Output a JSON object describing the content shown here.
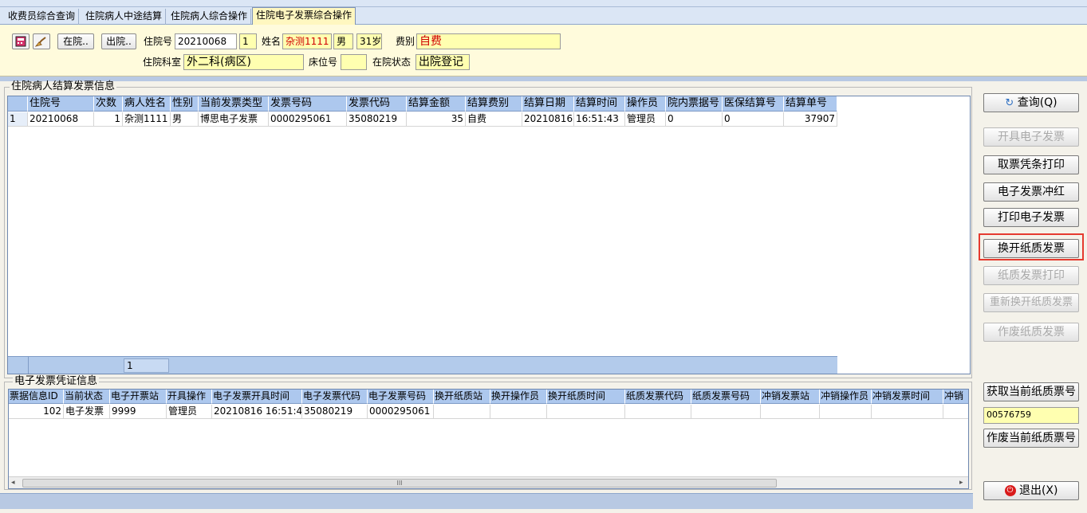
{
  "tabs": [
    {
      "label": "收费员综合查询"
    },
    {
      "label": "住院病人中途结算"
    },
    {
      "label": "住院病人综合操作"
    },
    {
      "label": "住院电子发票综合操作"
    }
  ],
  "header": {
    "btn_in": "在院..",
    "btn_out": "出院..",
    "label_zyh": "住院号",
    "zyh": "20210068",
    "times": "1",
    "label_name": "姓名",
    "name": "杂测1111",
    "sex": "男",
    "age": "31岁",
    "label_feibie": "费别",
    "feibie": "自费",
    "label_keshi": "住院科室",
    "keshi": "外二科(病区)",
    "label_bed": "床位号",
    "bed": "",
    "label_status": "在院状态",
    "status": "出院登记"
  },
  "settle_group": {
    "title": "住院病人结算发票信息",
    "columns": [
      "住院号",
      "次数",
      "病人姓名",
      "性别",
      "当前发票类型",
      "发票号码",
      "发票代码",
      "结算金额",
      "结算费别",
      "结算日期",
      "结算时间",
      "操作员",
      "院内票据号",
      "医保结算号",
      "结算单号"
    ],
    "rows": [
      {
        "idx": "1",
        "zyh": "20210068",
        "times": "1",
        "name": "杂测1111",
        "sex": "男",
        "type": "博思电子发票",
        "fphm": "0000295061",
        "fpdm": "35080219",
        "amount": "35",
        "feibie": "自费",
        "date": "20210816",
        "time": "16:51:43",
        "oper": "管理员",
        "ynph": "0",
        "ybjs": "0",
        "jsdh": "37907"
      }
    ],
    "footer_count": "1"
  },
  "voucher_group": {
    "title": "电子发票凭证信息",
    "columns": [
      "票据信息ID",
      "当前状态",
      "电子开票站",
      "开具操作",
      "电子发票开具时间",
      "电子发票代码",
      "电子发票号码",
      "换开纸质站",
      "换开操作员",
      "换开纸质时间",
      "纸质发票代码",
      "纸质发票号码",
      "冲销发票站",
      "冲销操作员",
      "冲销发票时间",
      "冲销"
    ],
    "rows": [
      {
        "id": "102",
        "status": "电子发票",
        "station": "9999",
        "oper": "管理员",
        "time": "20210816 16:51:4",
        "code": "35080219",
        "num": "0000295061"
      }
    ],
    "scroll_grip": "III"
  },
  "right_buttons": {
    "query": "查询(Q)",
    "open_einvoice": "开具电子发票",
    "print_voucher": "取票凭条打印",
    "red_einvoice": "电子发票冲红",
    "print_einvoice": "打印电子发票",
    "exchange_paper": "换开纸质发票",
    "print_paper": "纸质发票打印",
    "reexchange_paper": "重新换开纸质发票",
    "void_paper": "作废纸质发票",
    "get_paper_no": "获取当前纸质票号",
    "paper_no": "00576759",
    "void_paper_no": "作废当前纸质票号",
    "exit": "退出(X)"
  },
  "colors": {
    "highlight": "#e53a2f",
    "grid_header": "#adc8ee",
    "header_bg": "#fffbdc"
  }
}
